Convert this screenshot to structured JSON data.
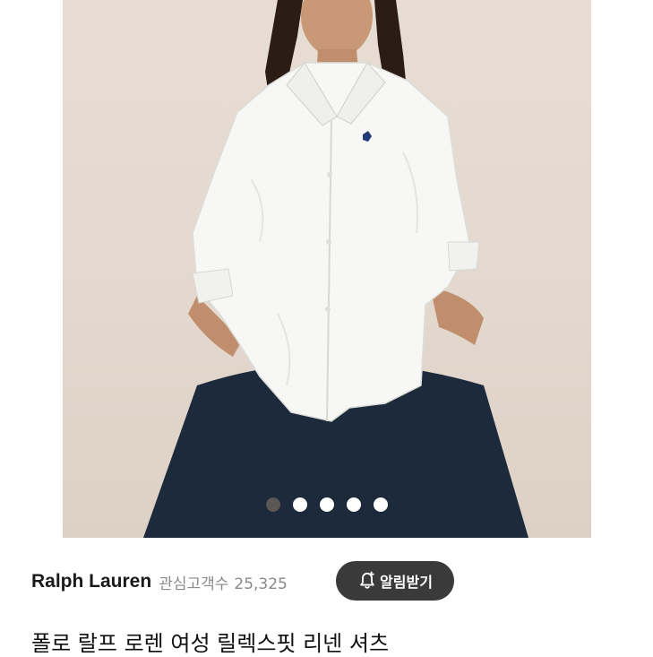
{
  "product_image": {
    "icon": "product-photo-image",
    "background": "#e4d9cf",
    "pager": {
      "count": 5,
      "active_index": 0,
      "active_color": "#5a5754",
      "inactive_color": "#ffffff"
    }
  },
  "brand": {
    "name": "Ralph Lauren",
    "watch_label": "관심고객수",
    "watch_count": "25,325"
  },
  "alert_button": {
    "label": "알림받기",
    "icon": "bell-plus-icon",
    "color": "#3a3a3a"
  },
  "product": {
    "title": "폴로 랄프 로렌 여성 릴렉스핏 리넨 셔츠"
  }
}
